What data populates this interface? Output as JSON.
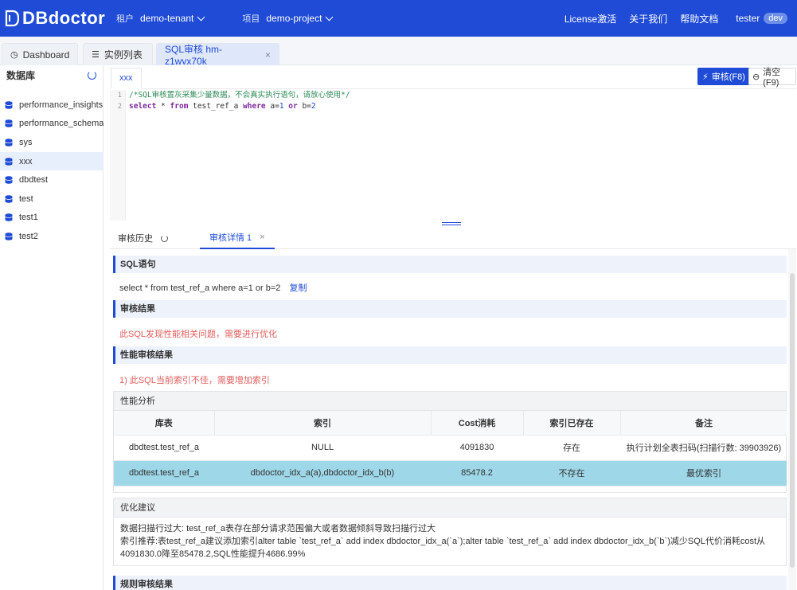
{
  "topbar": {
    "logo": "DBdoctor",
    "tenant_label": "租户",
    "tenant_value": "demo-tenant",
    "project_label": "项目",
    "project_value": "demo-project",
    "links": [
      "License激活",
      "关于我们",
      "帮助文档"
    ],
    "user": "tester",
    "user_badge": "dev"
  },
  "tabs": [
    {
      "label": "Dashboard",
      "icon": "dashboard-icon"
    },
    {
      "label": "实例列表",
      "icon": "list-icon"
    },
    {
      "label": "SQL审核 hm-z1wvx70k",
      "icon": "",
      "closable": true
    }
  ],
  "sidebar": {
    "title": "数据库",
    "items": [
      "performance_insights...",
      "performance_schema...",
      "sys",
      "xxx",
      "dbdtest",
      "test",
      "test1",
      "test2"
    ],
    "selected": "xxx"
  },
  "editor": {
    "tab": "xxx",
    "audit_button": "审核(F8)",
    "clear_button": "清空(F9)",
    "lines": [
      "1",
      "2"
    ],
    "comment": "/*SQL审核置灰采集少量数据，不会真实执行语句，请放心使用*/",
    "sql": {
      "kw1": "select",
      "star": " * ",
      "kw2": "from",
      "table": " test_ref_a ",
      "kw3": "where",
      "cond1": " a=",
      "n1": "1",
      "kw4": " or ",
      "cond2": "b=",
      "n2": "2"
    }
  },
  "bottom_tabs": {
    "history": "审核历史",
    "detail": "审核详情 1"
  },
  "sections": {
    "sql_title": "SQL语句",
    "sql_text": "select * from test_ref_a where a=1 or b=2",
    "copy": "复制",
    "result_title": "审核结果",
    "result_text": "此SQL发现性能相关问题，需要进行优化",
    "perf_title": "性能审核结果",
    "perf_text": "1) 此SQL当前索引不佳，需要增加索引",
    "analysis_title": "性能分析",
    "opt_title": "优化建议",
    "opt_line1": "数据扫描行过大: test_ref_a表存在部分请求范围偏大或者数据倾斜导致扫描行过大",
    "opt_line2": "索引推荐:表test_ref_a建议添加索引alter table `test_ref_a` add index dbdoctor_idx_a(`a`);alter table `test_ref_a` add index dbdoctor_idx_b(`b`)减少SQL代价消耗cost从",
    "opt_line3": "4091830.0降至85478.2,SQL性能提升4686.99%",
    "rule_title": "规则审核结果"
  },
  "table": {
    "headers": [
      "库表",
      "索引",
      "Cost消耗",
      "索引已存在",
      "备注"
    ],
    "rows": [
      [
        "dbdtest.test_ref_a",
        "NULL",
        "4091830",
        "存在",
        "执行计划全表扫码(扫描行数: 39903926)"
      ],
      [
        "dbdtest.test_ref_a",
        "dbdoctor_idx_a(a),dbdoctor_idx_b(b)",
        "85478.2",
        "不存在",
        "最优索引"
      ]
    ]
  },
  "colors": {
    "brand": "#1f4bd6",
    "highlight_row": "#9ed7e8",
    "warn": "#e35d5d"
  }
}
